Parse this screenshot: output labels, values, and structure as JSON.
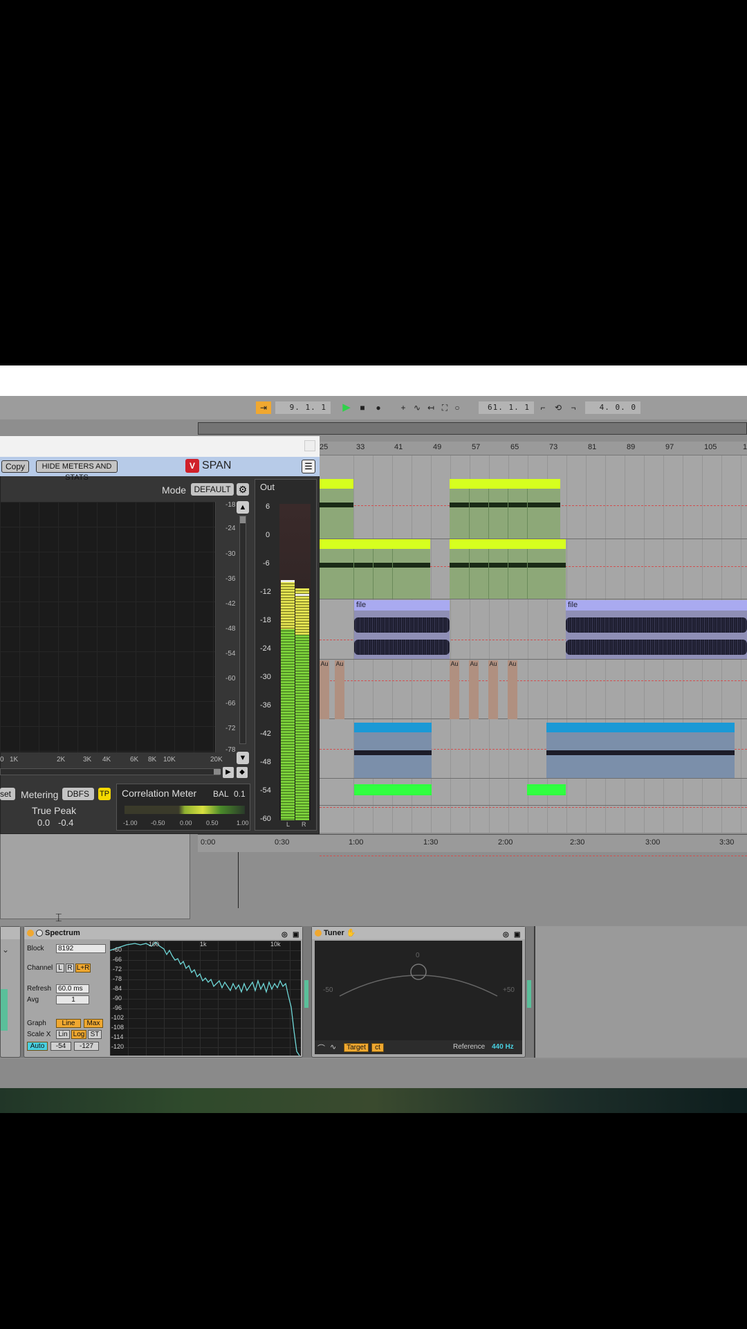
{
  "transport": {
    "position": "9. 1. 1",
    "loop_start": "61. 1. 1",
    "loop_length": "4. 0. 0"
  },
  "ruler": {
    "bars": [
      "25",
      "33",
      "41",
      "49",
      "57",
      "65",
      "73",
      "81",
      "89",
      "97",
      "105",
      "1"
    ]
  },
  "timeline": {
    "times": [
      "0:00",
      "0:30",
      "1:00",
      "1:30",
      "2:00",
      "2:30",
      "3:00",
      "3:30"
    ]
  },
  "clips": {
    "file_label": "file",
    "audio_label": "Au"
  },
  "span": {
    "copy_label": "Copy",
    "hide_label": "HIDE METERS AND STATS",
    "logo_text": "SPAN",
    "mode_label": "Mode",
    "mode_value": "DEFAULT",
    "out_label": "Out",
    "db_scale": [
      "-18",
      "-24",
      "-30",
      "-36",
      "-42",
      "-48",
      "-54",
      "-60",
      "-66",
      "-72",
      "-78"
    ],
    "freq_labels": [
      "0",
      "1K",
      "2K",
      "3K",
      "4K",
      "6K",
      "8K",
      "10K",
      "20K"
    ],
    "out_scale": [
      "6",
      "0",
      "-6",
      "-12",
      "-18",
      "-24",
      "-30",
      "-36",
      "-42",
      "-48",
      "-54",
      "-60"
    ],
    "meter_l": "L",
    "meter_r": "R",
    "set_label": "set",
    "metering_label": "Metering",
    "metering_value": "DBFS",
    "tp_label": "TP",
    "true_peak_label": "True Peak",
    "true_peak_l": "0.0",
    "true_peak_r": "-0.4",
    "correlation_label": "Correlation Meter",
    "bal_label": "BAL",
    "bal_value": "0.1",
    "corr_scale": [
      "-1.00",
      "-0.50",
      "0.00",
      "0.50",
      "1.00"
    ]
  },
  "spectrum": {
    "title": "Spectrum",
    "block_label": "Block",
    "block_value": "8192",
    "channel_label": "Channel",
    "channel_l": "L",
    "channel_r": "R",
    "channel_lr": "L+R",
    "refresh_label": "Refresh",
    "refresh_value": "60.0 ms",
    "avg_label": "Avg",
    "avg_value": "1",
    "graph_label": "Graph",
    "graph_line": "Line",
    "graph_max": "Max",
    "scalex_label": "Scale X",
    "scale_lin": "Lin",
    "scale_log": "Log",
    "scale_st": "ST",
    "auto_label": "Auto",
    "range_a": "-54",
    "range_b": "-127",
    "freq_labels": [
      "100",
      "1k",
      "10k"
    ],
    "db_labels": [
      "-60",
      "-66",
      "-72",
      "-78",
      "-84",
      "-90",
      "-96",
      "-102",
      "-108",
      "-114",
      "-120"
    ]
  },
  "tuner": {
    "title": "Tuner",
    "zero": "0",
    "minus": "-50",
    "plus": "+50",
    "target_label": "Target",
    "ct_label": "ct",
    "reference_label": "Reference",
    "reference_value": "440 Hz"
  },
  "colors": {
    "clip_lime": "#d6ff1f",
    "clip_blue": "#1a99d6",
    "clip_green": "#30ff40",
    "file_clip": "#a9aaf0",
    "accent_orange": "#f0a830",
    "accent_cyan": "#48d0e0"
  }
}
